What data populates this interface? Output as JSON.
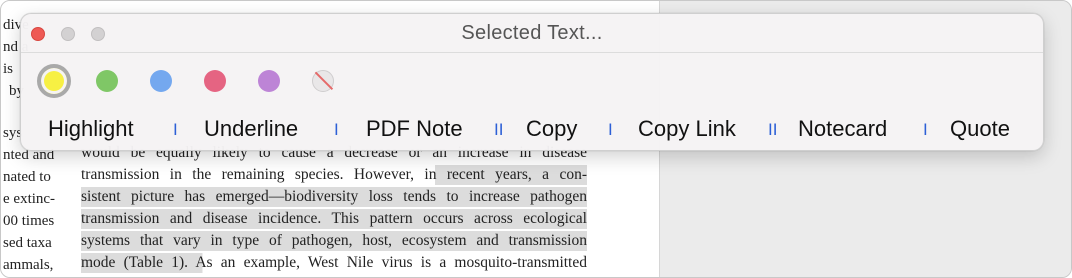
{
  "window": {
    "title": "Selected Text..."
  },
  "colors": {
    "swatches": [
      "#f7f043",
      "#7fc766",
      "#74a8ef",
      "#e56482",
      "#bd84d6"
    ],
    "separator": "#2d5fd6"
  },
  "actions": {
    "highlight": "Highlight",
    "underline": "Underline",
    "pdf_note": "PDF Note",
    "copy": "Copy",
    "copy_link": "Copy Link",
    "notecard": "Notecard",
    "quote": "Quote"
  },
  "separators": [
    "I",
    "I",
    "II",
    "I",
    "II",
    "I"
  ],
  "document": {
    "left_column": [
      "dive",
      "nd a",
      "is",
      "by",
      "sys",
      "nted and",
      "nated to",
      "e extinc-",
      "00 times",
      "sed taxa",
      "ammals,"
    ],
    "body_lines": [
      "would be equally likely to cause a decrease or an increase in disease",
      "transmission in the remaining species. However, in recent years, a con-",
      "sistent picture has emerged—biodiversity loss tends to increase pathogen",
      "transmission and disease incidence. This pattern occurs across ecological",
      "systems that vary in type of pathogen, host, ecosystem and transmission",
      "mode (Table 1). As an example, West Nile virus is a mosquito-transmitted"
    ]
  }
}
